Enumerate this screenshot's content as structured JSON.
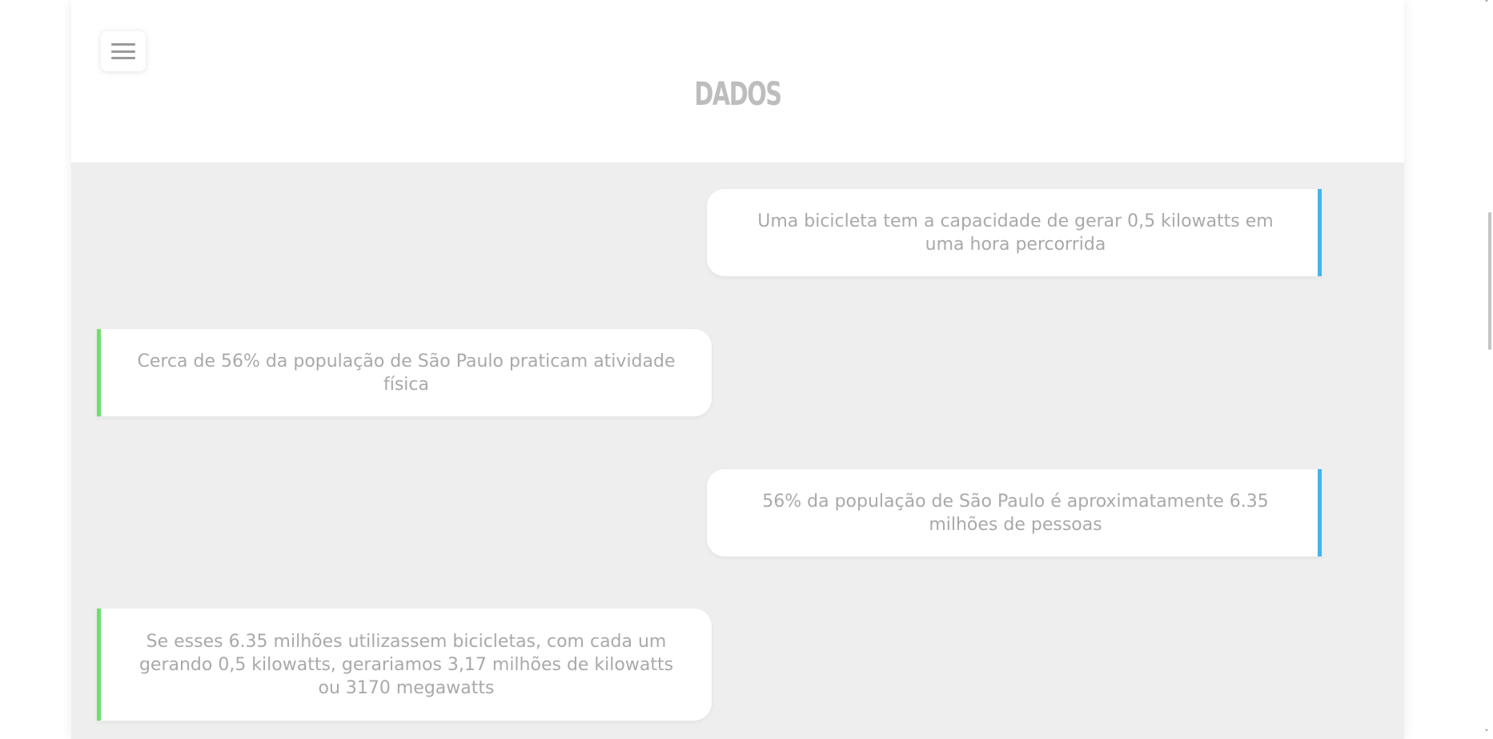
{
  "header": {
    "title": "DADOS",
    "menu_icon": "hamburger-menu-icon"
  },
  "cards": [
    {
      "text": "Uma bicicleta tem a capacidade de gerar 0,5 kilowatts em uma hora percorrida",
      "align": "right",
      "accent": "#42b6ec"
    },
    {
      "text": "Cerca de 56% da população de São Paulo praticam atividade física",
      "align": "left",
      "accent": "#6ee06a"
    },
    {
      "text": "56% da população de São Paulo é aproximatamente 6.35 milhões de pessoas",
      "align": "right",
      "accent": "#42b6ec"
    },
    {
      "text": "Se esses 6.35 milhões utilizassem bicicletas, com cada um gerando 0,5 kilowatts, gerariamos 3,17 milhões de kilowatts ou 3170 megawatts",
      "align": "left",
      "accent": "#6ee06a"
    }
  ],
  "scrollbar": {
    "up_arrow": "˄",
    "down_arrow": "˅"
  },
  "colors": {
    "content_background": "#eeeeee",
    "title": "#bdbdbd",
    "card_text": "#a9a9a9",
    "accent_blue": "#42b6ec",
    "accent_green": "#6ee06a"
  }
}
